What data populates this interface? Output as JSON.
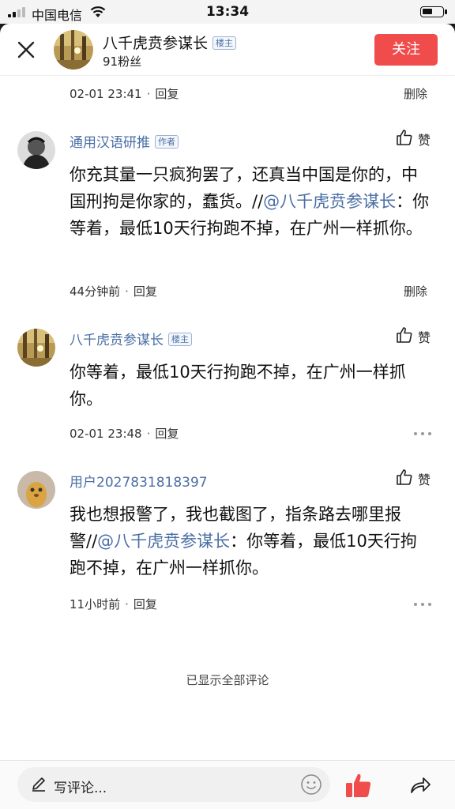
{
  "status_bar": {
    "carrier": "中国电信",
    "time": "13:34"
  },
  "header": {
    "name": "八千虎贲参谋长",
    "badge": "楼主",
    "fans": "91粉丝",
    "follow_label": "关注"
  },
  "top_meta": {
    "time": "02-01 23:41",
    "reply": "回复",
    "delete": "删除"
  },
  "comments": [
    {
      "name": "通用汉语研推",
      "badge": "作者",
      "like_label": "赞",
      "text_pre": "你充其量一只疯狗罢了，还真当中国是你的，中国刑拘是你家的，蠢货。//",
      "mention": "@八千虎贲参谋长",
      "text_post": "：你等着，最低10天行拘跑不掉，在广州一样抓你。",
      "time": "44分钟前",
      "reply": "回复",
      "delete": "删除"
    },
    {
      "name": "八千虎贲参谋长",
      "badge": "楼主",
      "like_label": "赞",
      "text": "你等着，最低10天行拘跑不掉，在广州一样抓你。",
      "time": "02-01 23:48",
      "reply": "回复"
    },
    {
      "name": "用户2027831818397",
      "like_label": "赞",
      "text_pre": "我也想报警了，我也截图了，指条路去哪里报警//",
      "mention": "@八千虎贲参谋长",
      "text_post": "：你等着，最低10天行拘跑不掉，在广州一样抓你。",
      "time": "11小时前",
      "reply": "回复"
    }
  ],
  "footer_note": "已显示全部评论",
  "bottom_bar": {
    "placeholder": "写评论..."
  },
  "colors": {
    "accent_link": "#4a6fa5",
    "follow_button": "#f04c4c",
    "like_active": "#f04c4c"
  },
  "icons": [
    "close-icon",
    "thumbs-up-icon",
    "more-dots-icon",
    "pencil-icon",
    "emoji-icon",
    "share-arrow-icon",
    "wifi-icon",
    "battery-icon",
    "signal-icon"
  ]
}
